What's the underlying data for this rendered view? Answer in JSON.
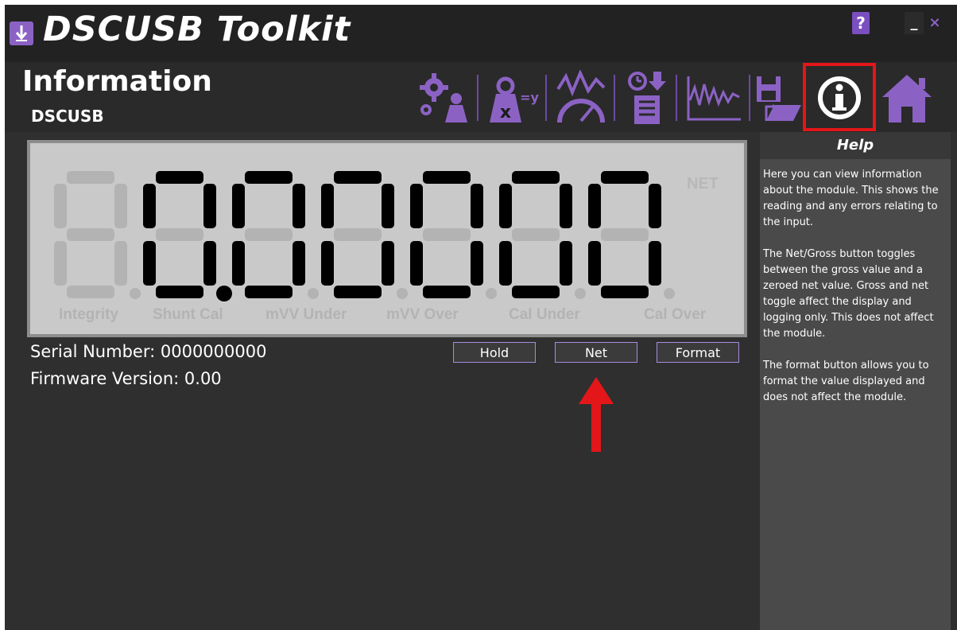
{
  "window": {
    "title": "DSCUSB Toolkit",
    "help_button_label": "?",
    "minimize_label": "_",
    "close_label": "×"
  },
  "header": {
    "title": "Information",
    "device": "DSCUSB"
  },
  "toolbar": {
    "icons": [
      "settings-gear-weight-icon",
      "calibration-xy-weight-icon",
      "gauge-chart-icon",
      "timer-log-icon",
      "waveform-chart-icon",
      "save-open-icon",
      "info-icon",
      "home-icon"
    ],
    "active": "info-icon"
  },
  "display": {
    "reading": "0.00000",
    "net_indicator": "NET",
    "flags": [
      "Integrity",
      "Shunt Cal",
      "mVV Under",
      "mVV Over",
      "Cal Under",
      "Cal Over"
    ]
  },
  "info": {
    "serial_label": "Serial Number:",
    "serial_value": "0000000000",
    "firmware_label": "Firmware Version:",
    "firmware_value": "0.00"
  },
  "buttons": {
    "hold": "Hold",
    "net": "Net",
    "format": "Format"
  },
  "help": {
    "title": "Help",
    "paragraph1": "Here you can view information about the module. This shows the reading and any errors relating to the input.",
    "paragraph2": "The Net/Gross button toggles between the gross value and a zeroed net value. Gross and net toggle affect the display and logging only. This does not affect the module.",
    "paragraph3": "The format button allows you to format the value displayed and does not affect the module."
  },
  "colors": {
    "accent": "#8b62c4",
    "highlight": "#e3161a",
    "lcd_background": "#c9c9c9",
    "segment_on": "#000000",
    "segment_off": "#b3b3b3"
  }
}
